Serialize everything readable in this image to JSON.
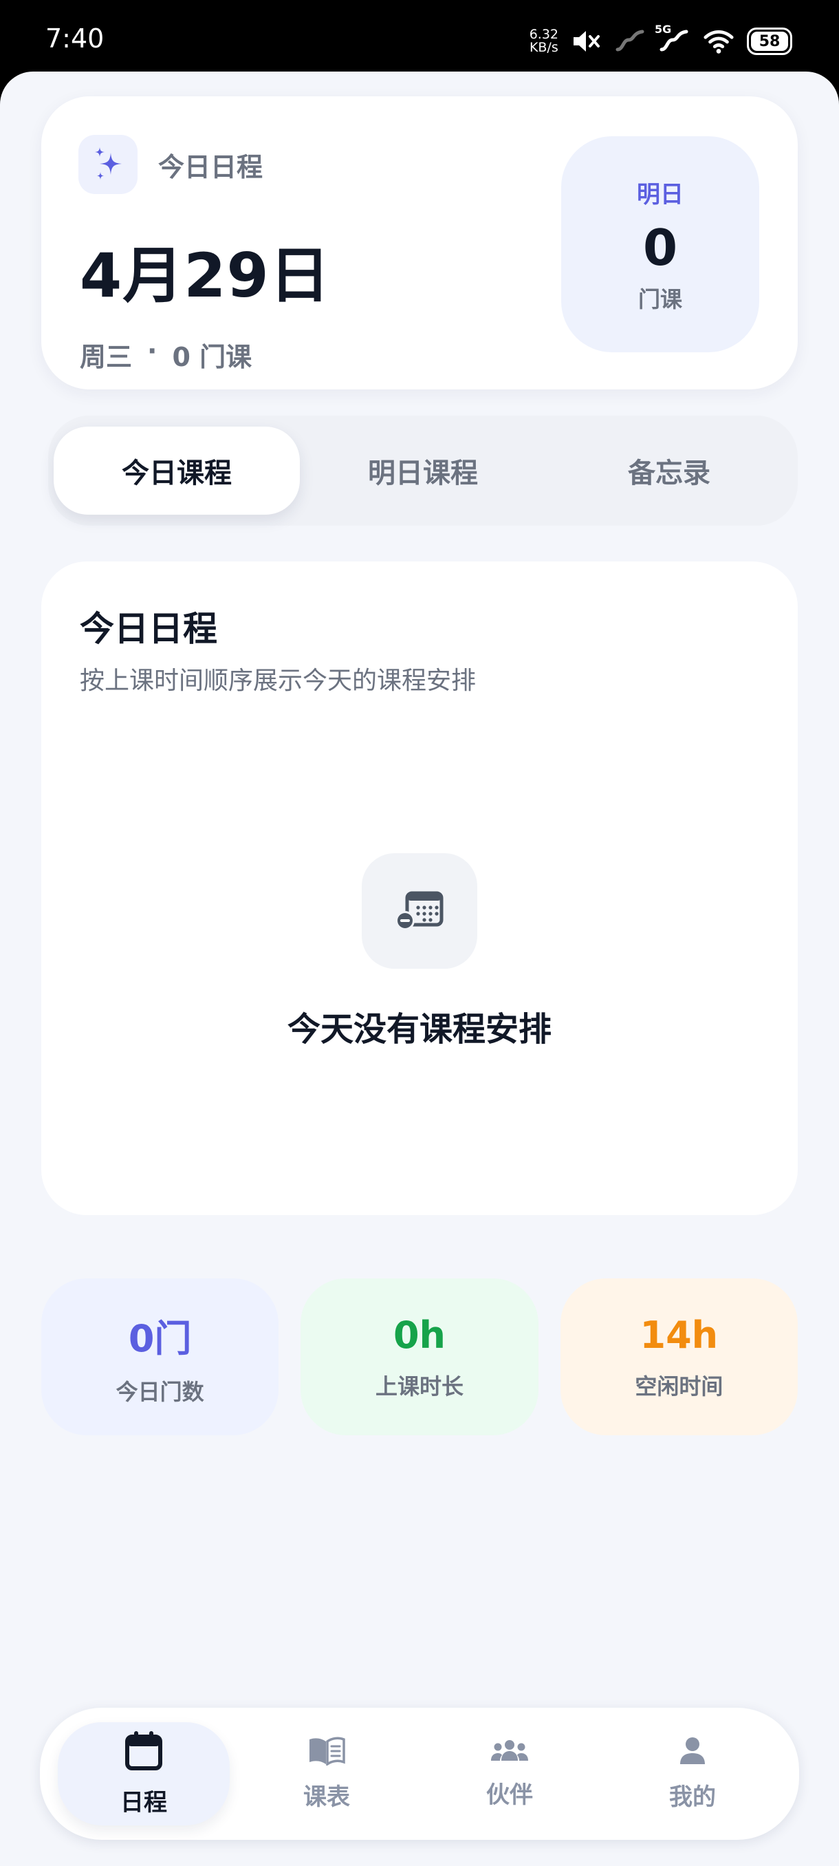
{
  "status_bar": {
    "time": "7:40",
    "net_speed_value": "6.32",
    "net_speed_unit": "KB/s",
    "network_type": "5G",
    "battery": "58"
  },
  "hero": {
    "badge_label": "今日日程",
    "date": "4月29日",
    "weekday": "周三",
    "separator": "·",
    "course_count": "0 门课",
    "tomorrow": {
      "title": "明日",
      "count": "0",
      "unit": "门课"
    }
  },
  "tabs": [
    {
      "label": "今日课程",
      "active": true
    },
    {
      "label": "明日课程",
      "active": false
    },
    {
      "label": "备忘录",
      "active": false
    }
  ],
  "schedule": {
    "title": "今日日程",
    "description": "按上课时间顺序展示今天的课程安排",
    "empty_text": "今天没有课程安排"
  },
  "stats": [
    {
      "value": "0门",
      "label": "今日门数"
    },
    {
      "value": "0h",
      "label": "上课时长"
    },
    {
      "value": "14h",
      "label": "空闲时间"
    }
  ],
  "nav": [
    {
      "label": "日程",
      "icon": "calendar-icon",
      "active": true
    },
    {
      "label": "课表",
      "icon": "book-icon",
      "active": false
    },
    {
      "label": "伙伴",
      "icon": "users-icon",
      "active": false
    },
    {
      "label": "我的",
      "icon": "user-icon",
      "active": false
    }
  ],
  "colors": {
    "accent": "#5b5fe0",
    "green": "#16a34a",
    "orange": "#f28c0f",
    "background": "#f4f6fb"
  }
}
